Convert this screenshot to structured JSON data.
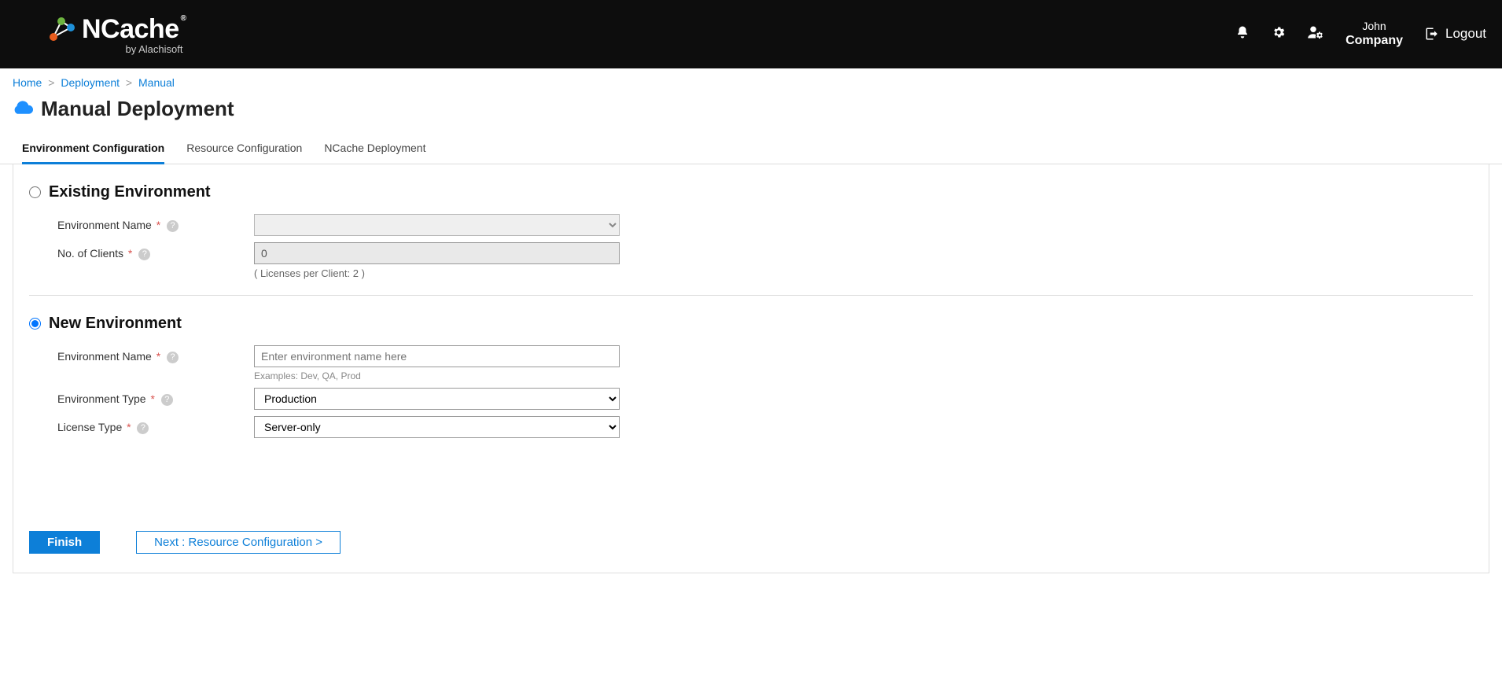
{
  "header": {
    "brand_name": "NCache",
    "brand_sub": "by Alachisoft",
    "user_name": "John",
    "user_company": "Company",
    "logout_label": "Logout"
  },
  "breadcrumb": {
    "home": "Home",
    "deployment": "Deployment",
    "manual": "Manual"
  },
  "page": {
    "title": "Manual Deployment"
  },
  "tabs": {
    "env": "Environment Configuration",
    "resource": "Resource Configuration",
    "deploy": "NCache Deployment"
  },
  "existing": {
    "heading": "Existing Environment",
    "env_name_label": "Environment Name",
    "env_name_value": "",
    "clients_label": "No. of Clients",
    "clients_value": "0",
    "clients_hint": "( Licenses per Client: 2 )"
  },
  "newenv": {
    "heading": "New Environment",
    "env_name_label": "Environment Name",
    "env_name_placeholder": "Enter environment name here",
    "env_name_hint": "Examples: Dev, QA, Prod",
    "env_type_label": "Environment Type",
    "env_type_value": "Production",
    "license_label": "License Type",
    "license_value": "Server-only"
  },
  "footer": {
    "finish": "Finish",
    "next": "Next : Resource Configuration >"
  }
}
